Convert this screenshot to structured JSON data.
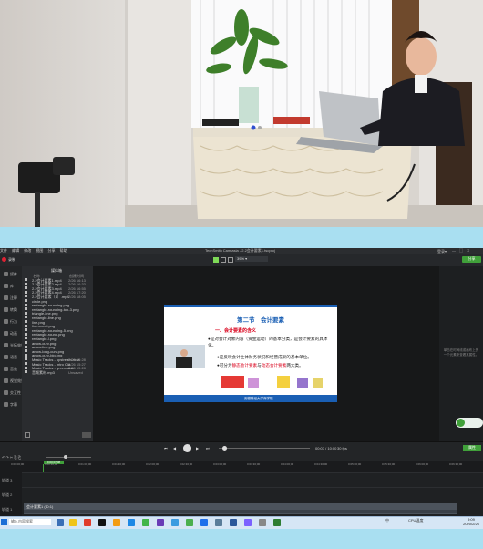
{
  "app": {
    "title": "TechSmith Camtasia - 2.2会计要素1.tscproj",
    "menu": [
      "文件",
      "编辑",
      "修改",
      "视图",
      "分享",
      "帮助"
    ],
    "record_label": "录制",
    "zoom_value": "39%",
    "share_label": "分享"
  },
  "nav": {
    "items": [
      "媒体",
      "库",
      "注释",
      "转换",
      "行为",
      "动画",
      "光标效果",
      "语音",
      "音效",
      "视觉效果",
      "交互性",
      "字幕"
    ]
  },
  "media_bin": {
    "title": "媒体箱",
    "col_name": "名称",
    "col_date": "创建时间",
    "files": [
      {
        "name": "2.2会计要素1.mp4",
        "date": "2/26 16:13"
      },
      {
        "name": "2.2会计要素2.mp4",
        "date": "2/26 16:33"
      },
      {
        "name": "2.2会计要素3.mp4",
        "date": "2/26 16:55"
      },
      {
        "name": "2.2会计要素4.mp4",
        "date": "2/26 17:20"
      },
      {
        "name": "2.2会计要素（1）.mp4",
        "date": "2/26 18:05"
      },
      {
        "name": "circle.png",
        "date": ""
      },
      {
        "name": "rectangle-rounding.png",
        "date": ""
      },
      {
        "name": "rectangle-rounding-top-3.png",
        "date": ""
      },
      {
        "name": "triangle-line.png",
        "date": ""
      },
      {
        "name": "rectangle-line.png",
        "date": ""
      },
      {
        "name": "line.png",
        "date": ""
      },
      {
        "name": "line-curv-l.png",
        "date": ""
      },
      {
        "name": "rectangle-rounding-5.png",
        "date": ""
      },
      {
        "name": "rectangle-round.png",
        "date": ""
      },
      {
        "name": "rectangle-l.png",
        "date": ""
      },
      {
        "name": "arrow-curv.png",
        "date": ""
      },
      {
        "name": "arrow-line.png",
        "date": ""
      },
      {
        "name": "arrow-long-curv.png",
        "date": ""
      },
      {
        "name": "arrow-curv-big.png",
        "date": ""
      },
      {
        "name": "Music Tracks - upstream.m4a",
        "date": "2/26 15:28"
      },
      {
        "name": "Music Tracks - Intro Cla.",
        "date": "2/26 15:27"
      },
      {
        "name": "Music Tracks - greenwave",
        "date": "2/26 15:28"
      },
      {
        "name": "音频素材.mp3",
        "date": "Unsaved"
      }
    ]
  },
  "slide": {
    "title": "第二节　会计要素",
    "heading": "一、会计要素的含义",
    "bullet1": "●是对会计对象内容（资金运动）的基本分类，是会计要素的具体化。",
    "bullet2": "●是反映会计主体财务状况和经营成果的基本单位。",
    "bullet3_pre": "●可分为",
    "bullet3_a": "静态会计要素",
    "bullet3_mid": "与",
    "bullet3_b": "动态会计要素",
    "bullet3_post": "两大类。",
    "footer": "安徽财经大学商学院"
  },
  "properties": {
    "hint": "单击在时间线或画布上的一个元素来查看其属性。"
  },
  "playback": {
    "time": "00:07 / 10:00",
    "fps": "30 fps",
    "props_label": "属性"
  },
  "timeline": {
    "playhead_time": "0:00:07:08",
    "ticks": [
      "0:00:00;00",
      "0:00:30;00",
      "0:01:00;00",
      "0:01:30;00",
      "0:02:00;00",
      "0:02:30;00",
      "0:03:00;00",
      "0:03:30;00",
      "0:04:00;00",
      "0:04:30;00",
      "0:05:00;00",
      "0:05:30;00",
      "0:06:00;00",
      "0:06:30;00"
    ],
    "tracks": [
      "轨道 3",
      "轨道 2",
      "轨道 1"
    ],
    "clip_label": "会计要素1 (ID:1)"
  },
  "taskbar": {
    "start_task": "输入内容搜索",
    "tray_time": "9:09",
    "tray_date": "2020/2/26",
    "tray_lang": "中",
    "tray_label": "CPU温度"
  },
  "colors": {
    "slide_blue": "#1a5fb4",
    "slide_red": "#d9001b",
    "accent_green": "#40a03a"
  }
}
